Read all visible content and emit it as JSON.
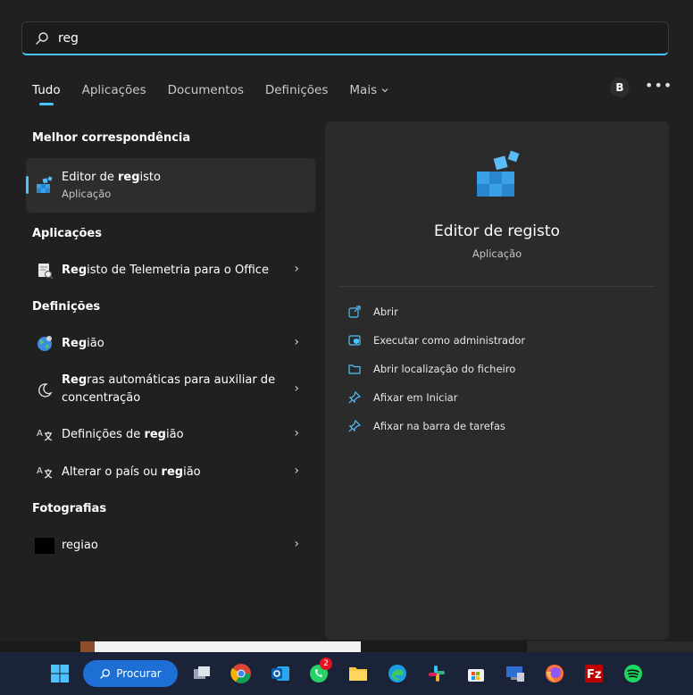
{
  "search": {
    "query": "reg"
  },
  "tabs": [
    {
      "label": "Tudo"
    },
    {
      "label": "Aplicações"
    },
    {
      "label": "Documentos"
    },
    {
      "label": "Definições"
    },
    {
      "label": "Mais"
    }
  ],
  "header": {
    "avatar_initial": "B",
    "more_label": "•••"
  },
  "best_match": {
    "title": "Melhor correspondência",
    "item": {
      "label_before": "Editor de ",
      "label_match": "reg",
      "label_after": "isto",
      "subtitle": "Aplicação",
      "icon": "registry-editor-icon"
    }
  },
  "apps": {
    "title": "Aplicações",
    "items": [
      {
        "label_match": "Reg",
        "label_after": "isto de Telemetria para o Office",
        "icon": "telemetry-log-icon"
      }
    ]
  },
  "settings": {
    "title": "Definições",
    "items": [
      {
        "label_before": "",
        "label_match": "Reg",
        "label_after": "ião",
        "icon": "globe-icon"
      },
      {
        "label_before": "",
        "label_match": "Reg",
        "label_after": "ras automáticas para auxiliar de concentração",
        "icon": "moon-icon"
      },
      {
        "label_before": "Definições de ",
        "label_match": "reg",
        "label_after": "ião",
        "icon": "language-icon"
      },
      {
        "label_before": "Alterar o país ou ",
        "label_match": "reg",
        "label_after": "ião",
        "icon": "language-icon"
      }
    ]
  },
  "photos": {
    "title": "Fotografias",
    "items": [
      {
        "label": "regiao",
        "icon": "photo-thumbnail"
      }
    ]
  },
  "detail": {
    "title": "Editor de registo",
    "subtitle": "Aplicação",
    "actions": [
      {
        "label": "Abrir",
        "icon": "open-icon"
      },
      {
        "label": "Executar como administrador",
        "icon": "admin-shield-icon"
      },
      {
        "label": "Abrir localização do ficheiro",
        "icon": "folder-icon"
      },
      {
        "label": "Afixar em Iniciar",
        "icon": "pin-icon"
      },
      {
        "label": "Afixar na barra de tarefas",
        "icon": "pin-icon"
      }
    ]
  },
  "taskbar": {
    "search_label": "Procurar",
    "whatsapp_badge": "2",
    "accent": "#4cc2ff"
  }
}
